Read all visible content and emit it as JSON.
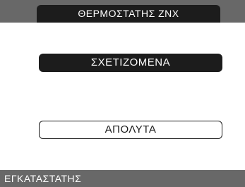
{
  "header": {
    "title": "ΘΕΡΜΟΣΤΑΤΗΣ ΖΝΧ"
  },
  "menu": {
    "options": [
      {
        "label": "ΣΧΕΤΙΖΟΜΕΝΑ",
        "selected": true
      },
      {
        "label": "ΑΠΟΛΥΤΑ",
        "selected": false
      }
    ]
  },
  "footer": {
    "level": "ΕΓΚΑΤΑΣΤΑΤΗΣ"
  },
  "colors": {
    "bar_gray": "#686868",
    "dark": "#1c1c1c",
    "background": "#ffffff"
  }
}
